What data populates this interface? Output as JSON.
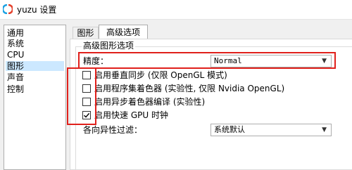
{
  "window": {
    "title": "yuzu 设置"
  },
  "colors": {
    "annotation_red": "#e0201b",
    "selection": "#cce8ff"
  },
  "sidebar": {
    "items": [
      {
        "label": "通用"
      },
      {
        "label": "系统"
      },
      {
        "label": "CPU"
      },
      {
        "label": "图形",
        "selected": true
      },
      {
        "label": "声音"
      },
      {
        "label": "控制"
      }
    ]
  },
  "tabs": [
    {
      "label": "图形",
      "active": false
    },
    {
      "label": "高级选项",
      "active": true
    }
  ],
  "advanced": {
    "group_title": "高级图形选项",
    "accuracy_label": "精度：",
    "accuracy_value": "Normal",
    "checkboxes": [
      {
        "label": "启用垂直同步 (仅限 OpenGL 模式)",
        "checked": false
      },
      {
        "label": "启用程序集着色器 (实验性, 仅限 Nvidia OpenGL)",
        "checked": false
      },
      {
        "label": "启用异步着色器编译 (实验性)",
        "checked": false
      },
      {
        "label": "启用快速 GPU 时钟",
        "checked": true
      }
    ],
    "anisotropic_label": "各向异性过滤：",
    "anisotropic_value": "系统默认"
  }
}
